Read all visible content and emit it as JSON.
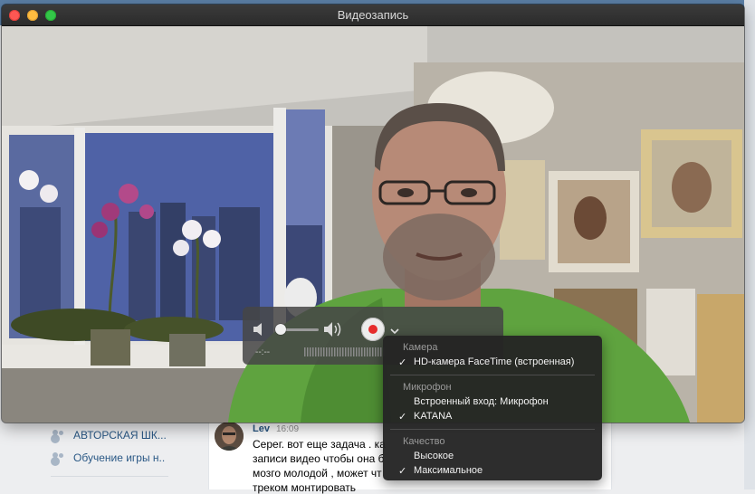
{
  "window": {
    "title": "Видеозапись"
  },
  "controls": {
    "time": "--:--"
  },
  "menu": {
    "sections": [
      {
        "header": "Камера",
        "items": [
          {
            "label": "HD-камера FaceTime (встроенная)",
            "checked": true
          }
        ]
      },
      {
        "header": "Микрофон",
        "items": [
          {
            "label": "Встроенный вход: Микрофон",
            "checked": false
          },
          {
            "label": "KATANA",
            "checked": true
          }
        ]
      },
      {
        "header": "Качество",
        "items": [
          {
            "label": "Высокое",
            "checked": false
          },
          {
            "label": "Максимальное",
            "checked": true
          }
        ]
      }
    ],
    "check_mark": "✓"
  },
  "background_page": {
    "sidebar": [
      "АВТОРСКАЯ ШК...",
      "Обучение игры н.."
    ],
    "message": {
      "author": "Lev",
      "time": "16:09",
      "lines": [
        "Серег. вот еще задача . ка",
        "записи видео чтобы она б",
        "мозго молодой , может чт",
        "треком монтировать"
      ]
    }
  },
  "colors": {
    "record": "#e62c2c",
    "titlebar": "#2f2f2f",
    "link": "#2a5885"
  }
}
